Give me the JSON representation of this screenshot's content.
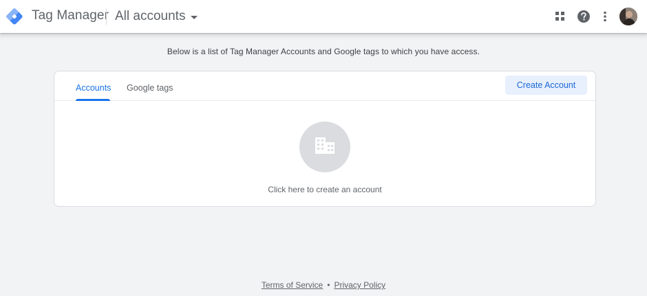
{
  "appbar": {
    "product_name": "Tag Manager",
    "account_switcher_label": "All accounts",
    "logo_colors": [
      "#8ab4f8",
      "#4285f4",
      "#1a73e8"
    ],
    "icons": [
      "apps-icon",
      "help-icon",
      "more-vert-icon",
      "avatar"
    ]
  },
  "main": {
    "intro_text": "Below is a list of Tag Manager Accounts and Google tags to which you have access.",
    "tabs": [
      {
        "label": "Accounts",
        "active": true
      },
      {
        "label": "Google tags",
        "active": false
      }
    ],
    "create_button_label": "Create Account",
    "empty_state": {
      "icon": "building-icon",
      "label": "Click here to create an account"
    }
  },
  "footer": {
    "terms_label": "Terms of Service",
    "separator": "•",
    "privacy_label": "Privacy Policy"
  },
  "colors": {
    "accent": "#1a73e8",
    "button_bg": "#e8f0fe",
    "page_bg": "#f1f3f4"
  }
}
